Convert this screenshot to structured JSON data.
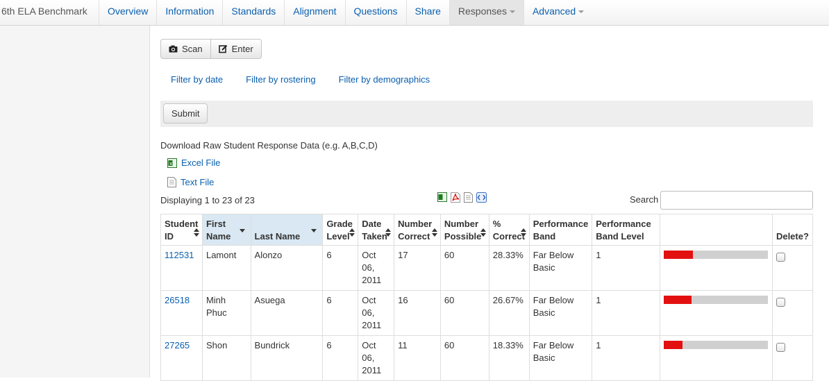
{
  "app": {
    "title": "6th ELA Benchmark"
  },
  "nav": [
    {
      "label": "Overview"
    },
    {
      "label": "Information"
    },
    {
      "label": "Standards"
    },
    {
      "label": "Alignment"
    },
    {
      "label": "Questions"
    },
    {
      "label": "Share"
    },
    {
      "label": "Responses",
      "active": true,
      "dropdown": true
    },
    {
      "label": "Advanced",
      "dropdown": true
    }
  ],
  "actions": {
    "scan": "Scan",
    "enter": "Enter",
    "scan_icon": "camera-icon",
    "enter_icon": "edit-icon"
  },
  "filters": {
    "date": "Filter by date",
    "rostering": "Filter by rostering",
    "demographics": "Filter by demographics"
  },
  "submit": "Submit",
  "download": {
    "title": "Download Raw Student Response Data (e.g. A,B,C,D)",
    "excel": "Excel File",
    "text": "Text File"
  },
  "table_info": {
    "displaying_prefix": "Displaying ",
    "start": "1",
    "to": " to ",
    "end": "23",
    "of": " of ",
    "total": "23",
    "search_label": "Search",
    "search_value": ""
  },
  "export_icons": [
    "excel-icon",
    "pdf-icon",
    "text-file-icon",
    "xml-icon"
  ],
  "columns": {
    "student_id": "Student ID",
    "first_name": "First Name",
    "last_name": "Last Name",
    "grade": "Grade Level",
    "date": "Date Taken",
    "num_correct": "Number Correct",
    "num_possible": "Number Possible",
    "pct": "% Correct",
    "band": "Performance Band",
    "band_level": "Performance Band Level",
    "chart": "",
    "delete": "Delete?"
  },
  "rows": [
    {
      "id": "112531",
      "first": "Lamont",
      "last": "Alonzo",
      "grade": "6",
      "date": "Oct 06, 2011",
      "correct": "17",
      "possible": "60",
      "pct": "28.33%",
      "band": "Far Below Basic",
      "level": "1",
      "fraction": 0.2833
    },
    {
      "id": "26518",
      "first": "Minh Phuc",
      "last": "Asuega",
      "grade": "6",
      "date": "Oct 06, 2011",
      "correct": "16",
      "possible": "60",
      "pct": "26.67%",
      "band": "Far Below Basic",
      "level": "1",
      "fraction": 0.2667
    },
    {
      "id": "27265",
      "first": "Shon",
      "last": "Bundrick",
      "grade": "6",
      "date": "Oct 06, 2011",
      "correct": "11",
      "possible": "60",
      "pct": "18.33%",
      "band": "Far Below Basic",
      "level": "1",
      "fraction": 0.1833
    }
  ],
  "colors": {
    "bar_fill": "#e31010",
    "bar_bg": "#d0d0d0",
    "link": "#0a5fae",
    "sorted_header": "#d9e8f2"
  }
}
